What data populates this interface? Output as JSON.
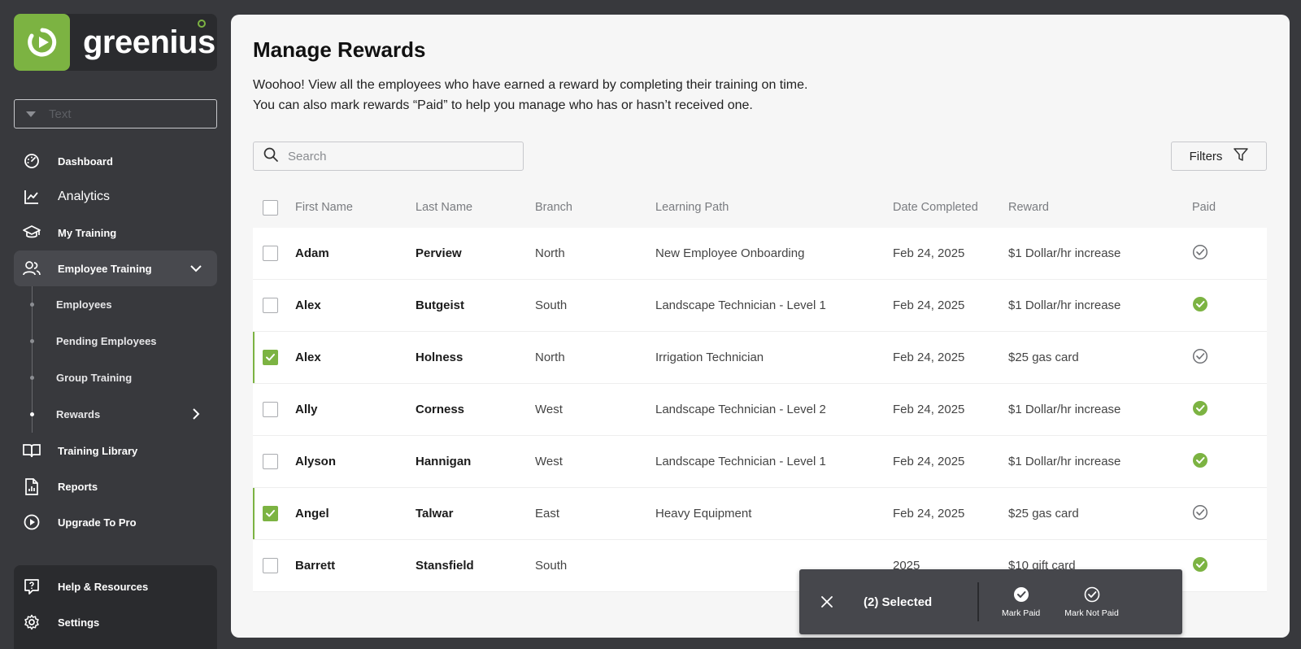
{
  "brand": {
    "name": "greenius",
    "accent": "#7cb342"
  },
  "org_select": {
    "placeholder": "Text"
  },
  "nav": {
    "items": [
      {
        "label": "Dashboard",
        "icon": "dashboard-gauge-icon"
      },
      {
        "label": "Analytics",
        "icon": "analytics-chart-icon"
      },
      {
        "label": "My Training",
        "icon": "graduation-cap-icon"
      },
      {
        "label": "Employee Training",
        "icon": "users-icon"
      }
    ],
    "sub_items": [
      {
        "label": "Employees"
      },
      {
        "label": "Pending Employees"
      },
      {
        "label": "Group Training"
      },
      {
        "label": "Rewards"
      }
    ],
    "more_items": [
      {
        "label": "Training Library",
        "icon": "book-icon"
      },
      {
        "label": "Reports",
        "icon": "report-icon"
      },
      {
        "label": "Upgrade To Pro",
        "icon": "play-circle-icon"
      }
    ],
    "bottom_items": [
      {
        "label": "Help & Resources",
        "icon": "help-icon"
      },
      {
        "label": "Settings",
        "icon": "gear-icon"
      }
    ]
  },
  "page": {
    "title": "Manage Rewards",
    "desc_line1": "Woohoo! View all the employees who have earned a reward by completing their training on time.",
    "desc_line2": "You can also mark rewards “Paid” to help you manage who has or hasn’t received one."
  },
  "search": {
    "placeholder": "Search"
  },
  "filters": {
    "label": "Filters"
  },
  "table": {
    "headers": {
      "first": "First Name",
      "last": "Last Name",
      "branch": "Branch",
      "path": "Learning Path",
      "date": "Date Completed",
      "reward": "Reward",
      "paid": "Paid"
    },
    "rows": [
      {
        "first": "Adam",
        "last": "Perview",
        "branch": "North",
        "path": "New Employee Onboarding",
        "date": "Feb 24, 2025",
        "reward": "$1 Dollar/hr increase",
        "paid": false,
        "selected": false
      },
      {
        "first": "Alex",
        "last": "Butgeist",
        "branch": "South",
        "path": "Landscape Technician - Level 1",
        "date": "Feb 24, 2025",
        "reward": "$1 Dollar/hr increase",
        "paid": true,
        "selected": false
      },
      {
        "first": "Alex",
        "last": "Holness",
        "branch": "North",
        "path": "Irrigation Technician",
        "date": "Feb 24, 2025",
        "reward": "$25 gas card",
        "paid": false,
        "selected": true
      },
      {
        "first": "Ally",
        "last": "Corness",
        "branch": "West",
        "path": "Landscape Technician - Level 2",
        "date": "Feb 24, 2025",
        "reward": "$1 Dollar/hr increase",
        "paid": true,
        "selected": false
      },
      {
        "first": "Alyson",
        "last": "Hannigan",
        "branch": "West",
        "path": "Landscape Technician - Level 1",
        "date": "Feb 24, 2025",
        "reward": "$1 Dollar/hr increase",
        "paid": true,
        "selected": false
      },
      {
        "first": "Angel",
        "last": "Talwar",
        "branch": "East",
        "path": "Heavy Equipment",
        "date": "Feb 24, 2025",
        "reward": "$25 gas card",
        "paid": false,
        "selected": true
      },
      {
        "first": "Barrett",
        "last": "Stansfield",
        "branch": "South",
        "path": "",
        "date": "2025",
        "reward": "$10 gift card",
        "paid": true,
        "selected": false
      }
    ]
  },
  "action_bar": {
    "count": "(2) Selected",
    "mark_paid": "Mark Paid",
    "mark_not_paid": "Mark Not Paid"
  }
}
